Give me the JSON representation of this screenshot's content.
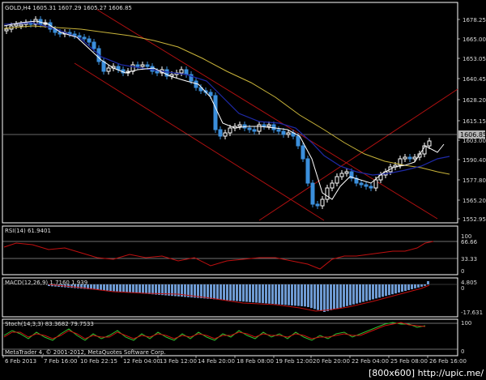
{
  "main": {
    "header": "GOLD,H4  1605.31 1607.29 1605.27 1606.85",
    "price_ticks": [
      "1678.25",
      "1665.00",
      "1653.05",
      "1640.45",
      "1628.20",
      "1615.15",
      "1603.00",
      "1590.40",
      "1577.80",
      "1565.20",
      "1552.95"
    ],
    "current_price": "1606.85"
  },
  "rsi": {
    "header": "RSI(14) 61.9401",
    "ticks": [
      "100",
      "66.66",
      "33.33",
      "0"
    ]
  },
  "macd": {
    "header": "MACD(12,26,9) 1.7160  1.939",
    "ticks": [
      "4.805",
      "0",
      "-17.631"
    ]
  },
  "stoch": {
    "header": "Stoch(14,3,3) 83.3682 79.7533",
    "ticks": [
      "100",
      "0"
    ]
  },
  "copyright": "MetaTrader 4, © 2001-2012, MetaQuotes Software Corp.",
  "time_axis": [
    "6 Feb 2013",
    "7 Feb 16:00",
    "10 Feb 22:15",
    "12 Feb 04:00",
    "13 Feb 12:00",
    "14 Feb 20:00",
    "18 Feb 08:00",
    "19 Feb 12:00",
    "20 Feb 20:00",
    "22 Feb 04:00",
    "25 Feb 08:00",
    "26 Feb 16:00"
  ],
  "watermark": "[800x600] http://upic.me/",
  "colors": {
    "bull": "#ffffff",
    "bear": "#3b8fdc",
    "ma_fast": "#ffffff",
    "ma_mid": "#1f2aa8",
    "ma_slow": "#c9b43a",
    "channel": "#b01010",
    "rsi": "#c01010",
    "macd_hist": "#6e9ad2",
    "macd_signal": "#c01010",
    "stoch_main": "#2fbf2f",
    "stoch_signal": "#d01010",
    "grid": "#ffffff"
  }
}
